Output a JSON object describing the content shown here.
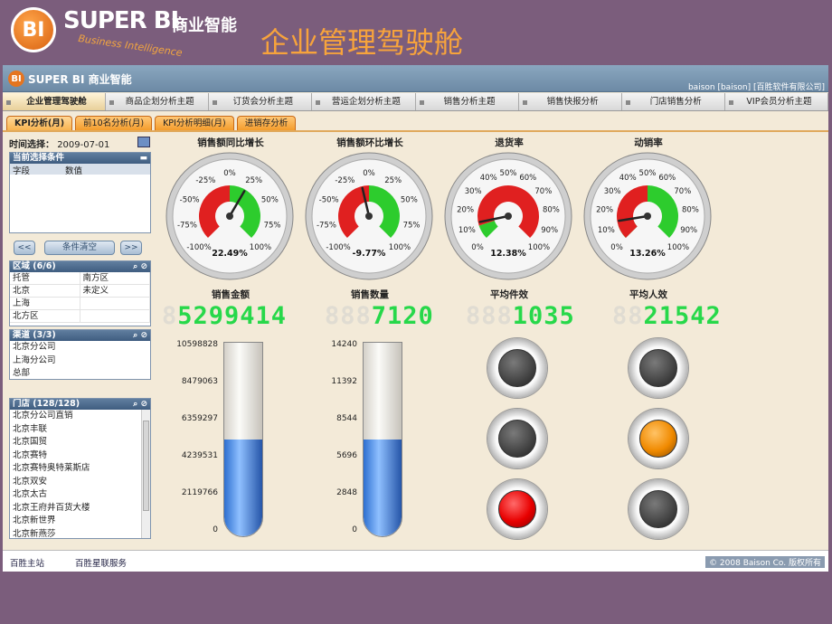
{
  "slide": {
    "logo_text": "BI",
    "brand": "SUPER BI",
    "brand_cn": "商业智能",
    "brand_en": "Business Intelligence",
    "title": "企业管理驾驶舱"
  },
  "app": {
    "logo_text": "BI",
    "name": "SUPER BI 商业智能",
    "user": "baison [baison] [百胜软件有限公司]"
  },
  "main_tabs": [
    "企业管理驾驶舱",
    "商品企划分析主题",
    "订货会分析主题",
    "营运企划分析主题",
    "销售分析主题",
    "销售快报分析",
    "门店销售分析",
    "VIP会员分析主题"
  ],
  "sub_tabs": [
    "KPI分析(月)",
    "前10名分析(月)",
    "KPI分析明细(月)",
    "进销存分析"
  ],
  "left": {
    "date_label": "时间选择：",
    "date_value": "2009-07-01",
    "conditions_title": "当前选择条件",
    "col_field": "字段",
    "col_value": "数值",
    "btn_prev": "<<",
    "btn_clear": "条件清空",
    "btn_next": ">>",
    "region_title": "区域 (6/6)",
    "regions": [
      [
        "托管",
        "南方区"
      ],
      [
        "北京",
        "未定义"
      ],
      [
        "上海",
        ""
      ],
      [
        "北方区",
        ""
      ]
    ],
    "channel_title": "渠道 (3/3)",
    "channels": [
      "北京分公司",
      "上海分公司",
      "总部"
    ],
    "store_title": "门店 (128/128)",
    "stores": [
      "北京分公司直销",
      "北京丰联",
      "北京国贸",
      "北京赛特",
      "北京赛特奥特莱斯店",
      "北京双安",
      "北京太古",
      "北京王府井百货大楼",
      "北京新世界",
      "北京新燕莎"
    ]
  },
  "gauges": [
    {
      "title": "销售额同比增长",
      "value": "22.49%",
      "labels": [
        "-100%",
        "-75%",
        "-50%",
        "-25%",
        "0%",
        "25%",
        "50%",
        "75%",
        "100%"
      ],
      "needle_pct": 22.49
    },
    {
      "title": "销售额环比增长",
      "value": "-9.77%",
      "labels": [
        "-100%",
        "-75%",
        "-50%",
        "-25%",
        "0%",
        "25%",
        "50%",
        "75%",
        "100%"
      ],
      "needle_pct": -9.77
    },
    {
      "title": "退货率",
      "value": "12.38%",
      "labels": [
        "0%",
        "10%",
        "20%",
        "30%",
        "40%",
        "50%",
        "60%",
        "70%",
        "80%",
        "90%",
        "100%"
      ],
      "needle_pct": 12.38
    },
    {
      "title": "动销率",
      "value": "13.26%",
      "labels": [
        "0%",
        "10%",
        "20%",
        "30%",
        "40%",
        "50%",
        "60%",
        "70%",
        "80%",
        "90%",
        "100%"
      ],
      "needle_pct": 13.26
    }
  ],
  "metrics": [
    {
      "title": "销售金额",
      "ghost": "8",
      "lit": "5299414"
    },
    {
      "title": "销售数量",
      "ghost": "888",
      "lit": "7120"
    },
    {
      "title": "平均件效",
      "ghost": "888",
      "lit": "1035"
    },
    {
      "title": "平均人效",
      "ghost": "88",
      "lit": "21542"
    }
  ],
  "tube1": {
    "labels": [
      "10598828",
      "8479063",
      "6359297",
      "4239531",
      "2119766",
      "0"
    ],
    "fill_fraction": 0.5
  },
  "tube2": {
    "labels": [
      "14240",
      "11392",
      "8544",
      "5696",
      "2848",
      "0"
    ],
    "fill_fraction": 0.5
  },
  "lights": {
    "col3": [
      "off",
      "off",
      "red"
    ],
    "col4": [
      "off",
      "orange",
      "off"
    ]
  },
  "footer": {
    "link1": "百胜主站",
    "link2": "百胜星联服务",
    "copyright": "© 2008 Baison Co. 版权所有"
  },
  "colors": {
    "accent": "#f7a33c",
    "digit": "#27d84a",
    "gauge_red": "#e02020",
    "gauge_green": "#2dcc2d"
  }
}
